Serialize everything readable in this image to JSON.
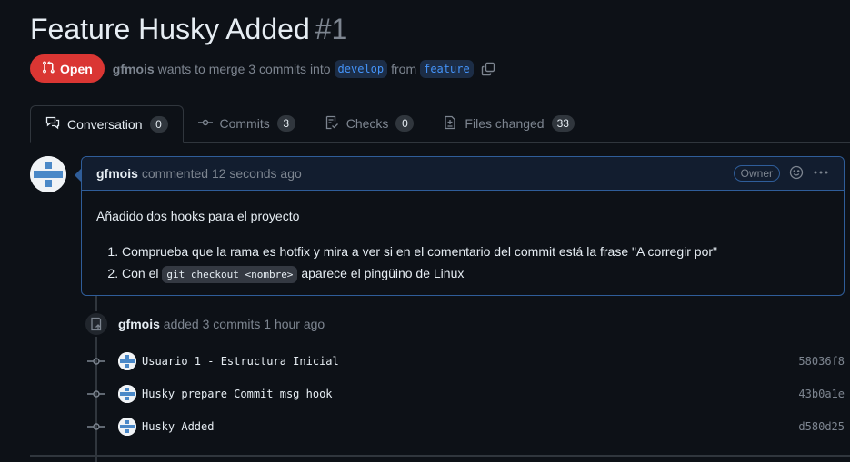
{
  "pr": {
    "title": "Feature Husky Added",
    "number": "#1",
    "state_label": "Open",
    "author": "gfmois",
    "merge_text": "wants to merge 3 commits into",
    "base_branch": "develop",
    "from_text": "from",
    "head_branch": "feature"
  },
  "tabs": [
    {
      "label": "Conversation",
      "count": "0"
    },
    {
      "label": "Commits",
      "count": "3"
    },
    {
      "label": "Checks",
      "count": "0"
    },
    {
      "label": "Files changed",
      "count": "33"
    }
  ],
  "comment": {
    "author": "gfmois",
    "action": "commented",
    "time": "12 seconds ago",
    "role": "Owner",
    "intro": "Añadido dos hooks para el proyecto",
    "items": [
      {
        "text": "Comprueba que la rama es hotfix y mira a ver si en el comentario del commit está la frase \"A corregir por\""
      },
      {
        "before": "Con el",
        "code": "git checkout <nombre>",
        "after": "aparece el pingüino de Linux"
      }
    ]
  },
  "commits_event": {
    "author": "gfmois",
    "text": "added 3 commits 1 hour ago"
  },
  "commits": [
    {
      "message": "Usuario 1 - Estructura Inicial",
      "sha": "58036f8"
    },
    {
      "message": "Husky prepare Commit msg hook",
      "sha": "43b0a1e"
    },
    {
      "message": "Husky Added",
      "sha": "d580d25"
    }
  ],
  "colors": {
    "background": "#0d1117",
    "open_badge": "#da3633",
    "accent_blue": "#4493f8",
    "comment_border": "#2f5d99"
  }
}
